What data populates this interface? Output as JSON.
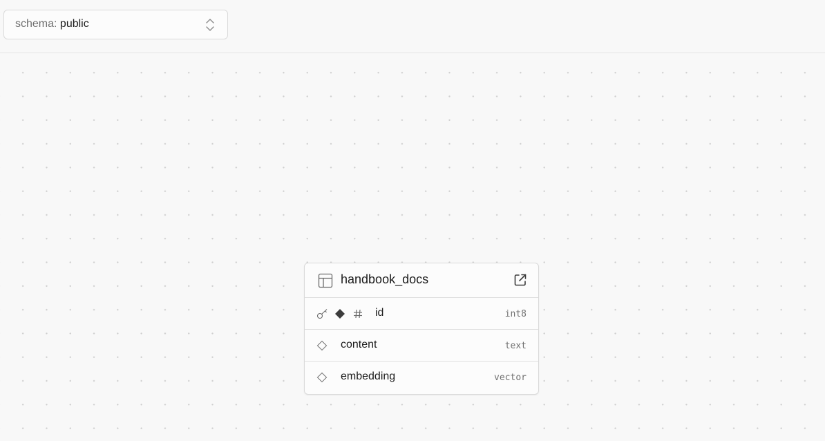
{
  "toolbar": {
    "schema_prefix": "schema: ",
    "schema_value": "public"
  },
  "table": {
    "name": "handbook_docs",
    "columns": [
      {
        "name": "id",
        "type": "int8",
        "primary_key": true,
        "identity": true,
        "not_null": true
      },
      {
        "name": "content",
        "type": "text",
        "primary_key": false,
        "identity": false,
        "not_null": false
      },
      {
        "name": "embedding",
        "type": "vector",
        "primary_key": false,
        "identity": false,
        "not_null": false
      }
    ]
  },
  "icons": {
    "schema_chevrons": "chevron-up-down-icon",
    "table": "table-icon",
    "open": "external-link-icon",
    "primary_key": "key-icon",
    "not_null": "diamond-filled-icon",
    "nullable": "diamond-outline-icon",
    "identity": "hash-icon"
  },
  "colors": {
    "background": "#f8f8f8",
    "dot": "#cfcfcf",
    "border": "#d9d9d9",
    "text": "#1c1c1c",
    "muted": "#707070"
  }
}
